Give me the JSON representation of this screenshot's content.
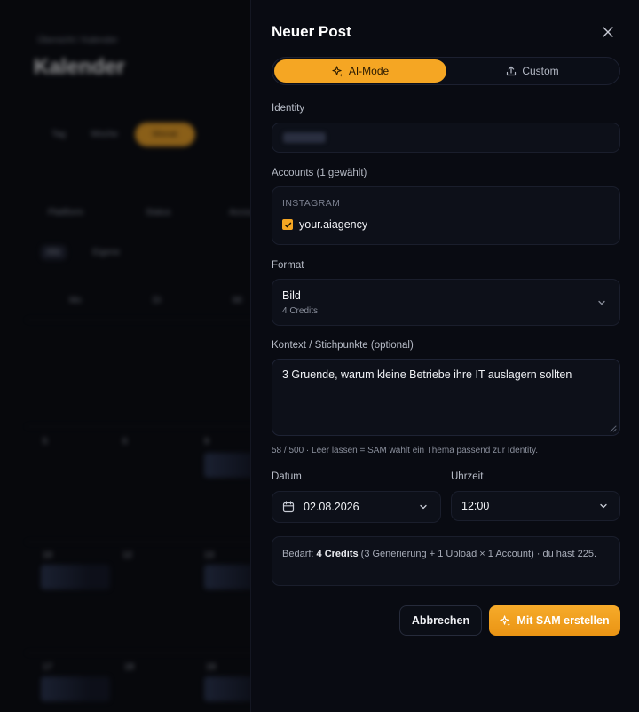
{
  "background": {
    "breadcrumb": "Übersicht / Kalender",
    "title": "Kalender",
    "view_tabs": [
      "Tag",
      "Woche",
      "Monat"
    ],
    "filters": [
      "Plattform",
      "Status",
      "Accounts"
    ],
    "chips": [
      "Alle",
      "Eigene"
    ],
    "weekdays": [
      "Mo",
      "Di",
      "Mi"
    ],
    "day_numbers": [
      "5",
      "6",
      "9",
      "10",
      "12",
      "13",
      "17",
      "18",
      "19"
    ]
  },
  "drawer": {
    "title": "Neuer Post",
    "close_icon": "close-icon",
    "modes": {
      "ai_label": "AI-Mode",
      "ai_icon": "sparkle-icon",
      "custom_label": "Custom",
      "custom_icon": "upload-icon",
      "selected": "ai"
    },
    "identity": {
      "label": "Identity",
      "value_redacted": true
    },
    "accounts": {
      "label": "Accounts (1 gewählt)",
      "category": "INSTAGRAM",
      "items": [
        {
          "name": "your.aiagency",
          "checked": true
        }
      ]
    },
    "format": {
      "label": "Format",
      "name": "Bild",
      "credits": "4 Credits"
    },
    "context": {
      "label": "Kontext / Stichpunkte (optional)",
      "value": "3 Gruende, warum kleine Betriebe ihre IT auslagern sollten",
      "hint": "58 / 500 · Leer lassen = SAM wählt ein Thema passend zur Identity."
    },
    "date": {
      "label": "Datum",
      "value": "02.08.2026",
      "icon": "calendar-icon"
    },
    "time": {
      "label": "Uhrzeit",
      "value": "12:00"
    },
    "cost": {
      "prefix": "Bedarf: ",
      "credits": "4 Credits",
      "suffix": " (3 Generierung + 1 Upload × 1 Account) · du hast 225."
    },
    "buttons": {
      "cancel": "Abbrechen",
      "create": "Mit SAM erstellen"
    }
  },
  "colors": {
    "accent": "#f5a623",
    "background": "#07080c",
    "panel": "#090b12",
    "field": "#0d1019"
  }
}
